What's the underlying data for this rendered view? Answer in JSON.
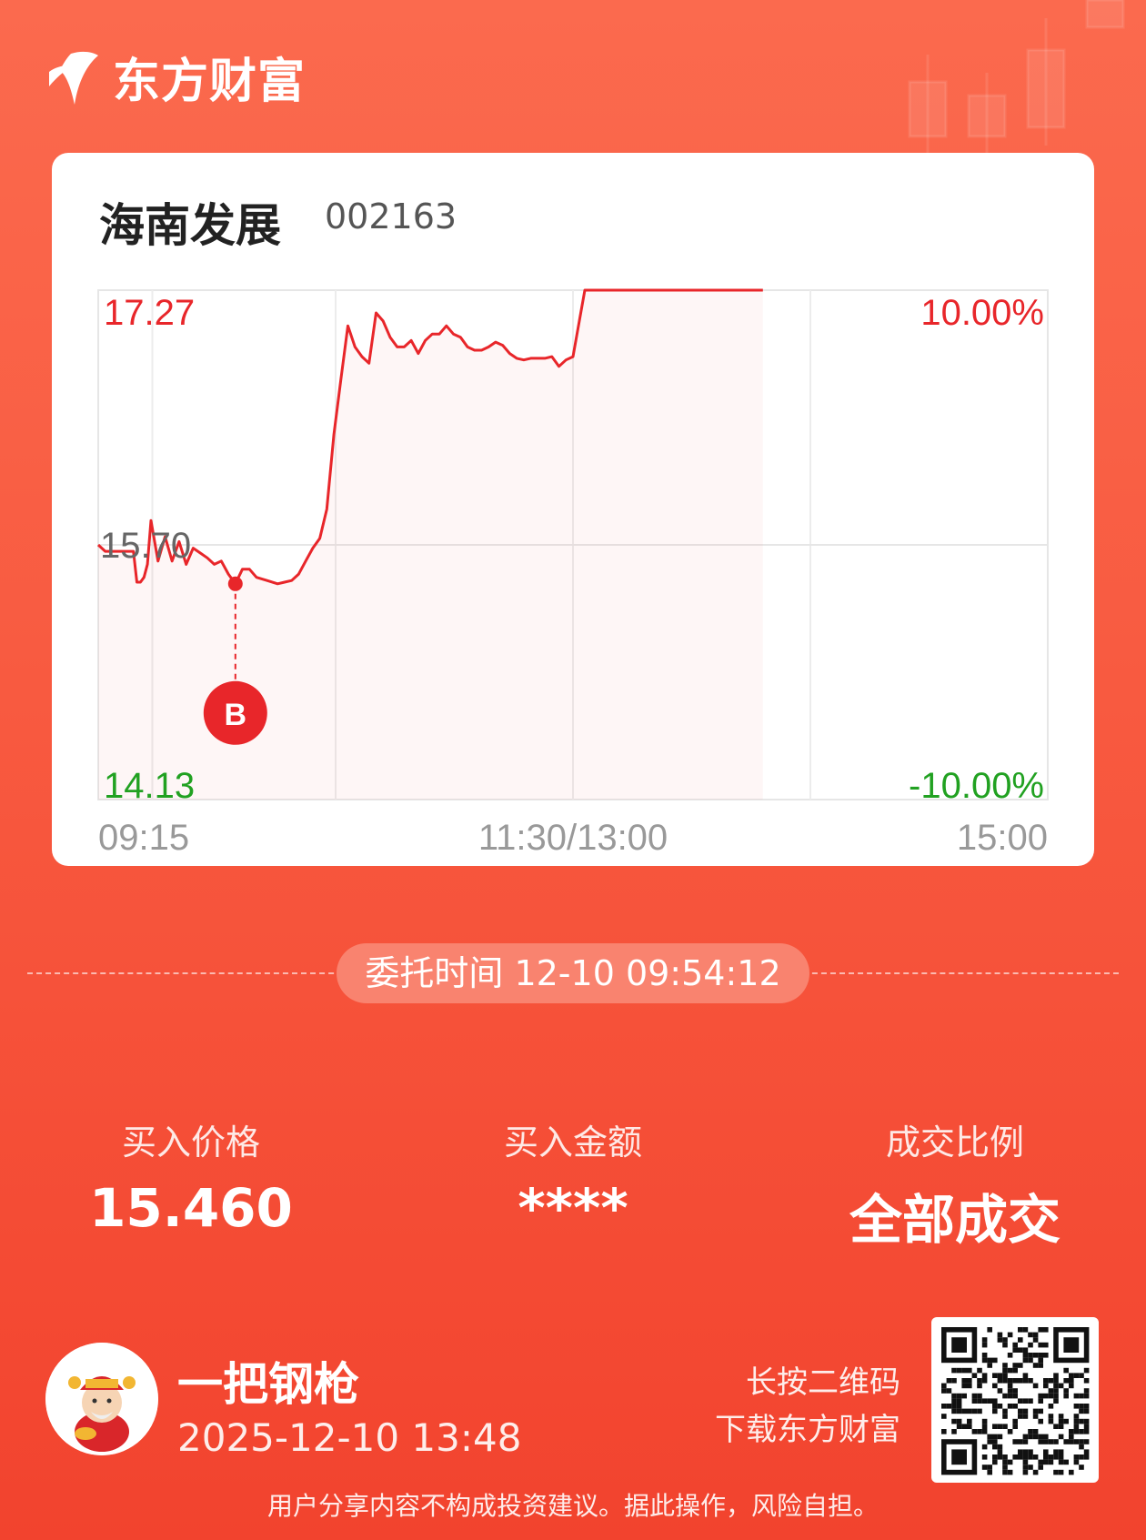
{
  "brand": {
    "name": "东方财富"
  },
  "stock": {
    "name": "海南发展",
    "code": "002163"
  },
  "chart_data": {
    "type": "line",
    "y_ticks_left": [
      "17.27",
      "15.70",
      "14.13"
    ],
    "y_ticks_right": [
      "10.00%",
      "-10.00%"
    ],
    "x_ticks": [
      "09:15",
      "11:30/13:00",
      "15:00"
    ],
    "ylim": [
      14.13,
      17.27
    ],
    "prev_close": 15.7,
    "grid": true,
    "series": [
      {
        "x": [
          "09:15",
          "09:17",
          "09:20",
          "09:22",
          "09:25",
          "09:26",
          "09:27",
          "09:28",
          "09:29",
          "09:30",
          "09:32",
          "09:34",
          "09:36",
          "09:38",
          "09:40",
          "09:42",
          "09:44",
          "09:46",
          "09:48",
          "09:50",
          "09:52",
          "09:54",
          "09:56",
          "09:58",
          "10:00",
          "10:03",
          "10:06",
          "10:08",
          "10:10",
          "10:12",
          "10:14",
          "10:16",
          "10:18",
          "10:20",
          "10:22",
          "10:24",
          "10:26",
          "10:28",
          "10:30",
          "10:32",
          "10:34",
          "10:36",
          "10:38",
          "10:40",
          "10:42",
          "10:44",
          "10:46",
          "10:48",
          "10:50",
          "10:52",
          "10:54",
          "10:56",
          "10:58",
          "11:00",
          "11:02",
          "11:04",
          "11:06",
          "11:08",
          "11:10",
          "11:12",
          "11:14",
          "11:16",
          "11:18",
          "11:20",
          "11:22",
          "11:24",
          "11:26",
          "11:28",
          "11:30",
          "13:01",
          "13:03",
          "13:05",
          "13:07",
          "13:09",
          "13:11",
          "13:13",
          "13:15",
          "13:17",
          "13:20",
          "13:23",
          "13:26",
          "13:29",
          "13:32",
          "13:35",
          "13:38",
          "13:41",
          "13:44",
          "13:47",
          "13:48"
        ],
        "values": [
          15.7,
          15.66,
          15.66,
          15.66,
          15.66,
          15.47,
          15.47,
          15.5,
          15.58,
          15.85,
          15.6,
          15.75,
          15.6,
          15.72,
          15.58,
          15.68,
          15.65,
          15.62,
          15.58,
          15.6,
          15.52,
          15.46,
          15.55,
          15.55,
          15.5,
          15.48,
          15.46,
          15.47,
          15.48,
          15.52,
          15.6,
          15.68,
          15.74,
          15.92,
          16.38,
          16.72,
          17.05,
          16.92,
          16.86,
          16.82,
          17.13,
          17.08,
          16.98,
          16.92,
          16.92,
          16.96,
          16.88,
          16.96,
          17.0,
          17.0,
          17.05,
          17.0,
          16.98,
          16.92,
          16.9,
          16.9,
          16.92,
          16.95,
          16.93,
          16.88,
          16.85,
          16.84,
          16.85,
          16.85,
          16.85,
          16.86,
          16.8,
          16.84,
          16.86,
          17.0,
          17.27,
          17.27,
          17.27,
          17.27,
          17.27,
          17.27,
          17.27,
          17.27,
          17.27,
          17.27,
          17.27,
          17.27,
          17.27,
          17.27,
          17.27,
          17.27,
          17.27,
          17.27,
          17.27
        ]
      }
    ],
    "marker": {
      "label": "B",
      "time": "09:54",
      "price": 15.46
    }
  },
  "order": {
    "time_label": "委托时间 12-10 09:54:12"
  },
  "stats": [
    {
      "label": "买入价格",
      "value": "15.460"
    },
    {
      "label": "买入金额",
      "value": "****"
    },
    {
      "label": "成交比例",
      "value": "全部成交"
    }
  ],
  "user": {
    "name": "一把钢枪",
    "time": "2025-12-10 13:48"
  },
  "qr_hint": {
    "line1": "长按二维码",
    "line2": "下载东方财富"
  },
  "disclaimer": "用户分享内容不构成投资建议。据此操作，风险自担。",
  "colors": {
    "accent": "#e8262a",
    "down": "#21a121",
    "bg": "#f85a40"
  }
}
